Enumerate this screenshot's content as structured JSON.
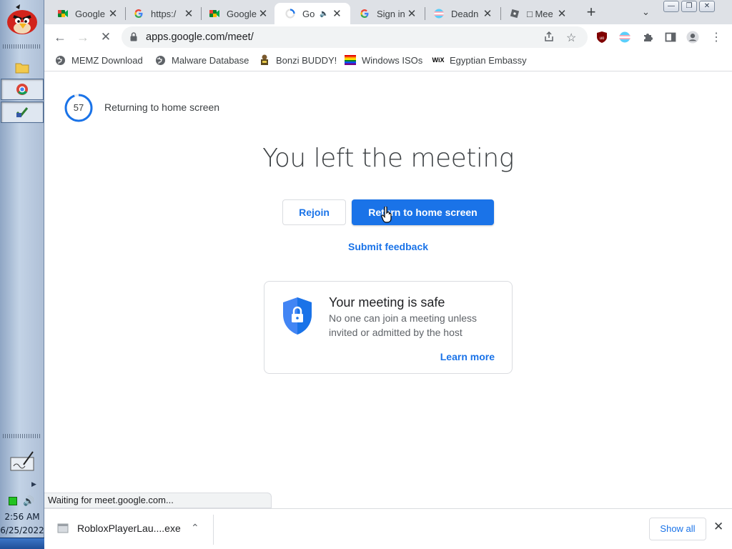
{
  "taskbar": {
    "time": "2:56 AM",
    "date": "6/25/2022"
  },
  "tabs": [
    {
      "title": "Google",
      "icon": "google-meet-icon"
    },
    {
      "title": "https:/",
      "icon": "google-icon"
    },
    {
      "title": "Google",
      "icon": "google-meet-icon"
    },
    {
      "title": "Go",
      "icon": "loading-icon",
      "active": true,
      "audio": true
    },
    {
      "title": "Sign in",
      "icon": "google-icon"
    },
    {
      "title": "Deadn",
      "icon": "flag-icon"
    },
    {
      "title": "□ Mee",
      "icon": "roblox-icon"
    }
  ],
  "toolbar": {
    "url": "apps.google.com/meet/"
  },
  "bookmarks": [
    {
      "label": "MEMZ Download",
      "icon": "globe-icon"
    },
    {
      "label": "Malware Database",
      "icon": "globe-icon"
    },
    {
      "label": "Bonzi BUDDY!",
      "icon": "bonzi-icon"
    },
    {
      "label": "Windows ISOs",
      "icon": "rainbow-flag-icon"
    },
    {
      "label": "Egyptian Embassy",
      "icon": "wix-icon"
    }
  ],
  "page": {
    "countdown": "57",
    "countdown_label": "Returning to home screen",
    "headline": "You left the meeting",
    "rejoin_label": "Rejoin",
    "home_label": "Return to home screen",
    "feedback_label": "Submit feedback",
    "safety": {
      "title": "Your meeting is safe",
      "text": "No one can join a meeting unless invited or admitted by the host",
      "link": "Learn more"
    }
  },
  "status_bar": "Waiting for meet.google.com...",
  "downloads": {
    "file": "RobloxPlayerLau....exe",
    "show_all": "Show all"
  },
  "colors": {
    "accent": "#1a73e8",
    "tabstrip": "#dee1e6"
  }
}
